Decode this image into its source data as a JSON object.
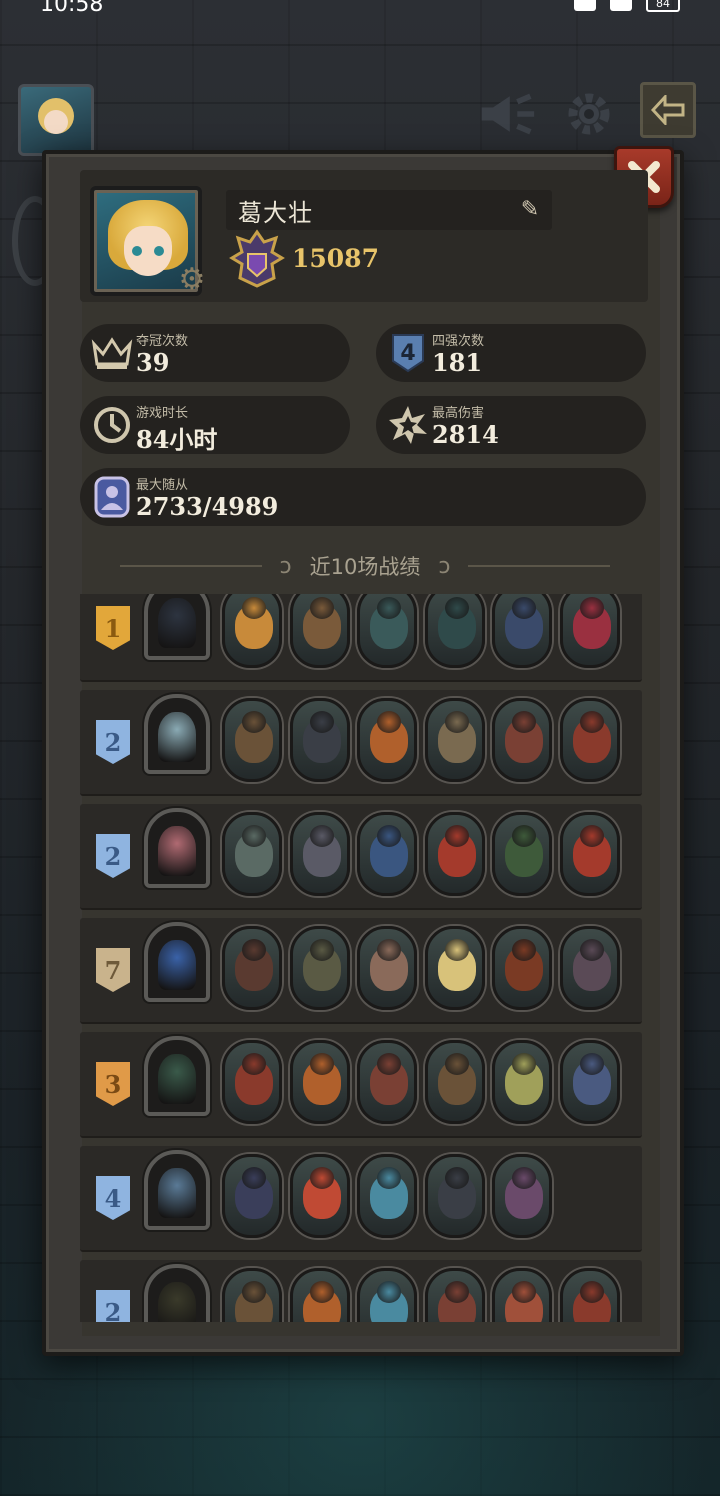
{
  "status_bar": {
    "time": "10:58",
    "battery": "84"
  },
  "profile": {
    "player_name": "葛大壮",
    "rank_score": "15087",
    "edit_icon": "pencil-icon",
    "settings_icon": "gear-icon"
  },
  "stats": [
    {
      "key": "championships",
      "label": "夺冠次数",
      "value": "39",
      "icon": "crown-icon"
    },
    {
      "key": "top4",
      "label": "四强次数",
      "value": "181",
      "icon": "four-shield-icon"
    },
    {
      "key": "playtime",
      "label": "游戏时长",
      "value": "84小时",
      "icon": "clock-icon"
    },
    {
      "key": "max_damage",
      "label": "最高伤害",
      "value": "2814",
      "icon": "burst-icon"
    },
    {
      "key": "max_minions",
      "label": "最大随从",
      "value": "2733/4989",
      "icon": "portrait-icon"
    }
  ],
  "section_title": "近10场战绩",
  "colors": {
    "panel": "#3b3936",
    "card": "#24221f",
    "gold": "#e8c46a",
    "rank_gold": "#e2a73a",
    "rank_blue": "#8fb4e0",
    "rank_tan": "#c9b38c",
    "rank_orange": "#e09a48",
    "close_red": "#a83a2a"
  },
  "matches": [
    {
      "place": "1",
      "badge_color": "#e2a73a",
      "badge_text": "#8a5a10",
      "hero": "#2d3440",
      "minions": [
        "#c88a3a",
        "#7a5a3a",
        "#3a5a5a",
        "#2f4a4a",
        "#3a4a6a",
        "#9a3040"
      ]
    },
    {
      "place": "2",
      "badge_color": "#8fb4e0",
      "badge_text": "#3a5a86",
      "hero": "#8aaab4",
      "minions": [
        "#6a5238",
        "#3a3e46",
        "#b0602c",
        "#7a6a50",
        "#7a4034",
        "#8a3a2c"
      ]
    },
    {
      "place": "2",
      "badge_color": "#8fb4e0",
      "badge_text": "#3a5a86",
      "hero": "#b06a72",
      "minions": [
        "#5a6a64",
        "#5a5a66",
        "#3a5680",
        "#a43a2c",
        "#3e5a3a",
        "#a43a2c"
      ]
    },
    {
      "place": "7",
      "badge_color": "#c9b38c",
      "badge_text": "#6e5a3a",
      "hero": "#3a62a8",
      "minions": [
        "#5a3a30",
        "#5a5a44",
        "#8a6a5a",
        "#d8c27a",
        "#7a3a24",
        "#5a4a56"
      ]
    },
    {
      "place": "3",
      "badge_color": "#e09a48",
      "badge_text": "#7a4a14",
      "hero": "#3a5a4a",
      "minions": [
        "#8a3a2c",
        "#b0602c",
        "#7a4034",
        "#6a5238",
        "#a0a05a",
        "#4a5a80"
      ]
    },
    {
      "place": "4",
      "badge_color": "#8fb4e0",
      "badge_text": "#3a5a86",
      "hero": "#5a7a96",
      "minions": [
        "#3a3e5a",
        "#c04a34",
        "#4a8aa0",
        "#3a3e46",
        "#6a4a6a"
      ]
    },
    {
      "place": "2",
      "badge_color": "#8fb4e0",
      "badge_text": "#3a5a86",
      "hero": "#3a3a2a",
      "minions": [
        "#6a5238",
        "#b0602c",
        "#4a8aa0",
        "#7a4034",
        "#a0503a",
        "#8a3a2c"
      ]
    }
  ]
}
